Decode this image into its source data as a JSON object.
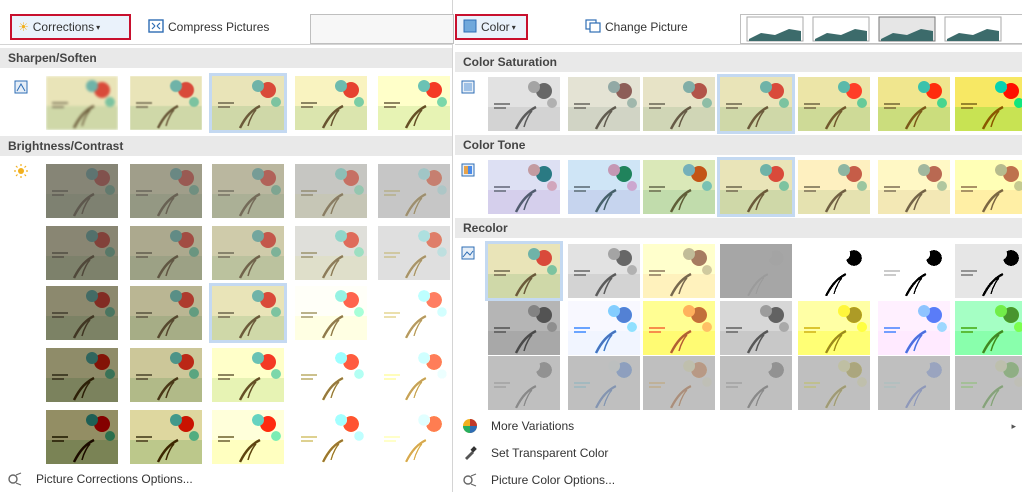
{
  "left": {
    "corrections_label": "Corrections",
    "compress_label": "Compress Pictures",
    "sharpen_header": "Sharpen/Soften",
    "brightness_header": "Brightness/Contrast",
    "options_label": "Picture Corrections Options..."
  },
  "right": {
    "color_label": "Color",
    "change_label": "Change Picture",
    "saturation_header": "Color Saturation",
    "tone_header": "Color Tone",
    "recolor_header": "Recolor",
    "more_variations": "More Variations",
    "set_transparent": "Set Transparent Color",
    "color_options": "Picture Color Options..."
  },
  "colors": {
    "accent_red": "#c8102e",
    "selection": "#c4d9f1",
    "header_bg": "#e9e9e9"
  }
}
